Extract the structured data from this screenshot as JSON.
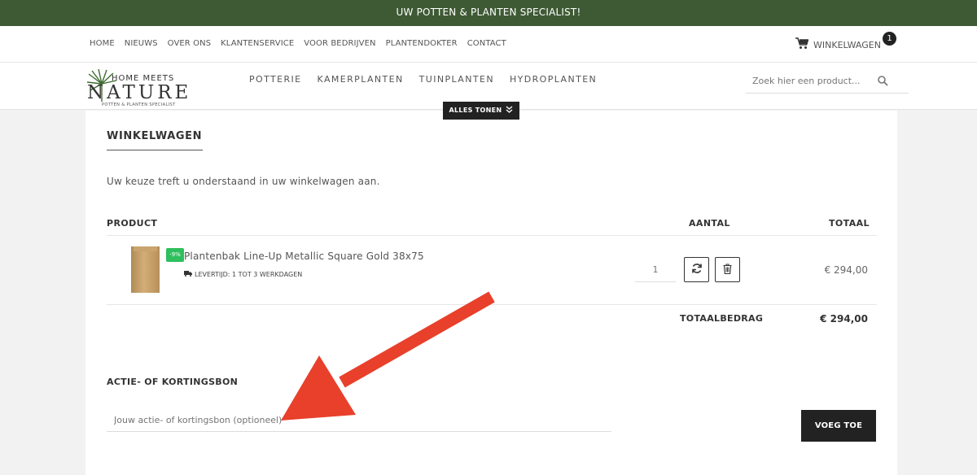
{
  "promo": {
    "text": "UW POTTEN & PLANTEN SPECIALIST!"
  },
  "topnav": {
    "links": [
      "HOME",
      "NIEUWS",
      "OVER ONS",
      "KLANTENSERVICE",
      "VOOR BEDRIJVEN",
      "PLANTENDOKTER",
      "CONTACT"
    ],
    "cart_label": "WINKELWAGEN",
    "cart_count": "1"
  },
  "logo": {
    "line1": "HOME MEETS",
    "line2": "NATURE",
    "tagline": "POTTEN & PLANTEN SPECIALIST"
  },
  "catnav": [
    "POTTERIE",
    "KAMERPLANTEN",
    "TUINPLANTEN",
    "HYDROPLANTEN"
  ],
  "search": {
    "placeholder": "Zoek hier een product..."
  },
  "show_all": "ALLES TONEN",
  "cart": {
    "title": "WINKELWAGEN",
    "intro": "Uw keuze treft u onderstaand in uw winkelwagen aan.",
    "headers": {
      "product": "PRODUCT",
      "quantity": "AANTAL",
      "total": "TOTAAL"
    },
    "item": {
      "name": "Plantenbak Line-Up Metallic Square Gold 38x75",
      "discount": "-9%",
      "delivery": "LEVERTIJD: 1 TOT 3 WERKDAGEN",
      "quantity": "1",
      "price": "€ 294,00"
    },
    "total_label": "TOTAALBEDRAG",
    "total_value": "€ 294,00"
  },
  "coupon": {
    "title": "ACTIE- OF KORTINGSBON",
    "placeholder": "Jouw actie- of kortingsbon (optioneel)",
    "button": "VOEG TOE"
  },
  "colors": {
    "promo_bg": "#3e5a34",
    "badge_green": "#2fbf5e",
    "annotation_arrow": "#e8402a"
  }
}
